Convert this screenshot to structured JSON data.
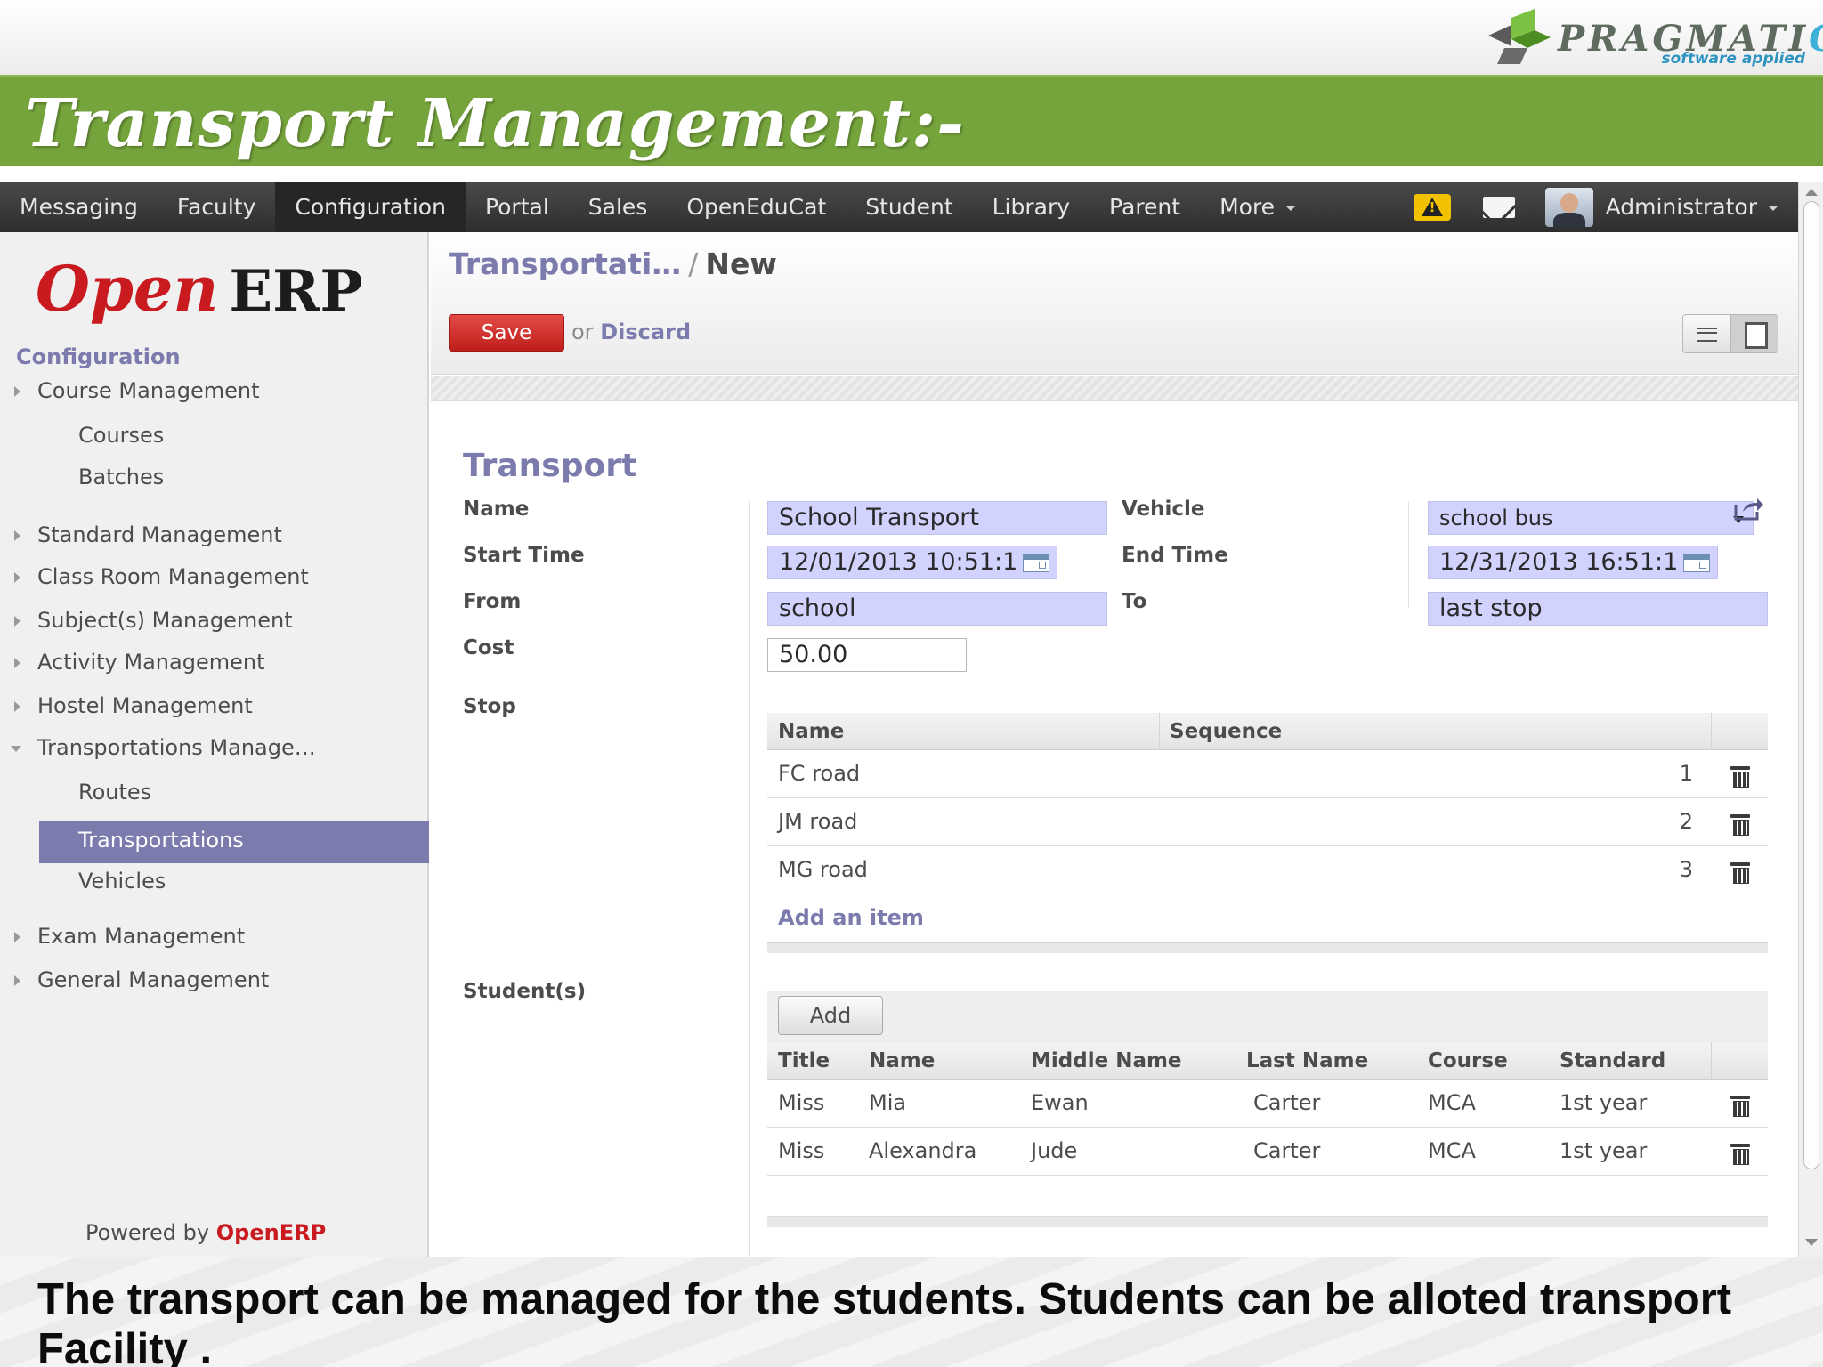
{
  "slide": {
    "title": "Transport Management:-",
    "logo_text_main": "PRAGMATI",
    "logo_text_c": "C",
    "logo_tagline": "software applied",
    "caption": "The transport can be managed for the students. Students can be alloted transport Facility ."
  },
  "topbar": {
    "menu": [
      "Messaging",
      "Faculty",
      "Configuration",
      "Portal",
      "Sales",
      "OpenEduCat",
      "Student",
      "Library",
      "Parent"
    ],
    "active_menu": "Configuration",
    "more_label": "More",
    "user_label": "Administrator"
  },
  "sidebar": {
    "logo_open": "Open",
    "logo_erp": "ERP",
    "section": "Configuration",
    "items": {
      "course": "Course Management",
      "courses": "Courses",
      "batches": "Batches",
      "standard": "Standard Management",
      "classroom": "Class Room Management",
      "subject": "Subject(s) Management",
      "activity": "Activity Management",
      "hostel": "Hostel Management",
      "transportations_mgmt": "Transportations Manage…",
      "routes": "Routes",
      "transportations": "Transportations",
      "vehicles": "Vehicles",
      "exam": "Exam Management",
      "general": "General Management"
    },
    "powered_prefix": "Powered by",
    "powered_brand": "OpenERP"
  },
  "control_panel": {
    "breadcrumb_parent": "Transportati…",
    "breadcrumb_sep": "/",
    "breadcrumb_current": "New",
    "save_label": "Save",
    "or_label": "or",
    "discard_label": "Discard"
  },
  "form": {
    "heading": "Transport",
    "labels": {
      "name": "Name",
      "vehicle": "Vehicle",
      "start_time": "Start Time",
      "end_time": "End Time",
      "from": "From",
      "to": "To",
      "cost": "Cost",
      "stop": "Stop",
      "students": "Student(s)"
    },
    "values": {
      "name": "School Transport",
      "vehicle": "school bus",
      "start_time": "12/01/2013 10:51:1",
      "end_time": "12/31/2013 16:51:1",
      "from": "school",
      "to": "last stop",
      "cost": "50.00"
    }
  },
  "stops": {
    "headers": {
      "name": "Name",
      "sequence": "Sequence"
    },
    "rows": [
      {
        "name": "FC road",
        "sequence": "1"
      },
      {
        "name": "JM road",
        "sequence": "2"
      },
      {
        "name": "MG road",
        "sequence": "3"
      }
    ],
    "add_item_label": "Add an item"
  },
  "students": {
    "add_label": "Add",
    "headers": {
      "title": "Title",
      "name": "Name",
      "middle_name": "Middle Name",
      "last_name": "Last Name",
      "course": "Course",
      "standard": "Standard"
    },
    "rows": [
      {
        "title": "Miss",
        "name": "Mia",
        "middle_name": "Ewan",
        "last_name": "Carter",
        "course": "MCA",
        "standard": "1st year"
      },
      {
        "title": "Miss",
        "name": "Alexandra",
        "middle_name": "Jude",
        "last_name": "Carter",
        "course": "MCA",
        "standard": "1st year"
      }
    ]
  },
  "colors": {
    "brand_green": "#76a43c",
    "accent_purple": "#7c7bad",
    "required_field": "#d2d2ff",
    "save_red": "#d9302c",
    "openerp_red": "#c81a1f"
  }
}
